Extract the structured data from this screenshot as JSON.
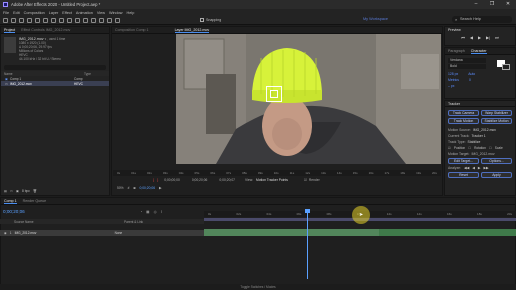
{
  "window": {
    "title": "Adobe After Effects 2020 - Untitled Project.aep *",
    "controls": [
      "–",
      "❐",
      "✕"
    ]
  },
  "menu": [
    "File",
    "Edit",
    "Composition",
    "Layer",
    "Effect",
    "Animation",
    "View",
    "Window",
    "Help"
  ],
  "toolbar": {
    "snapping_label": "Snapping",
    "workspace": "My Workspace",
    "search_placeholder": "Search Help"
  },
  "project": {
    "tabs": [
      "Project",
      "Effect Controls IMG_2012.mov"
    ],
    "file_name": "IMG_2012.mov",
    "file_used": "▾ , used 1 time",
    "file_info": [
      "1080 x 1920 (1.00)",
      "Δ 0;00;20;06, 29.97 fps",
      "Millions of Colors",
      "HEVC",
      "44.100 kHz / 32 bit U / Stereo"
    ],
    "columns": [
      "Name",
      "",
      "Type"
    ],
    "items": [
      {
        "name": "Comp 1",
        "type": "Comp"
      },
      {
        "name": "IMG_2012.mov",
        "type": "HEVC"
      }
    ],
    "footer_bpc": "8 bpc"
  },
  "composition": {
    "tab": "Composition Comp 1",
    "layer_tab": "Layer IMG_2012.mov",
    "ruler": [
      "0s",
      "01s",
      "02s",
      "03s",
      "04s",
      "05s",
      "06s",
      "07s",
      "08s",
      "09s",
      "10s",
      "11s",
      "12s",
      "13s",
      "14s",
      "15s",
      "16s",
      "17s",
      "18s",
      "19s",
      "20s"
    ],
    "time_in": "0;00;00;00",
    "time_current": "0;00;20;06",
    "time_duration": "0;00;20;07",
    "zoom": "50%",
    "view_label": "View:",
    "view_value": "Motion Tracker Points",
    "render_label": "Render",
    "timecode_bottom": "0;00;20;06"
  },
  "preview": {
    "title": "Preview"
  },
  "typography": {
    "tabs": [
      "Paragraph",
      "Character"
    ],
    "font": "Verdana",
    "style": "Bold",
    "size": "128 px",
    "leading": "Auto",
    "kerning": "Metrics",
    "tracking": "0",
    "stroke": "– px"
  },
  "tracker": {
    "title": "Tracker",
    "buttons": [
      "Track Camera",
      "Warp Stabilizer",
      "Track Motion",
      "Stabilize Motion"
    ],
    "motion_source_label": "Motion Source:",
    "motion_source": "IMG_2012.mov",
    "current_track_label": "Current Track:",
    "current_track": "Tracker 1",
    "track_type_label": "Track Type:",
    "track_type": "Stabilize",
    "checkboxes": [
      "Position",
      "Rotation",
      "Scale"
    ],
    "motion_target_label": "Motion Target:",
    "motion_target": "IMG_2012.mov",
    "edit_target": "Edit Target...",
    "options": "Options...",
    "analyze": "Analyze:",
    "reset": "Reset",
    "apply": "Apply"
  },
  "timeline": {
    "tabs": [
      "Comp 1",
      "Render Queue"
    ],
    "timecode": "0;00;20;06",
    "columns": [
      "Source Name",
      "Parent & Link"
    ],
    "layer": {
      "index": "1",
      "name": "IMG_2012.mov",
      "parent": "None"
    },
    "ruler": [
      "0s",
      "02s",
      "04s",
      "06s",
      "08s",
      "10s",
      "12s",
      "14s",
      "16s",
      "18s",
      "20s"
    ],
    "footer": "Toggle Switches / Modes"
  },
  "colors": {
    "accent": "#4a8ef0",
    "playhead": "#5aa0ff",
    "beanie": "#d7f23a",
    "track_bar": "#3f7a4a"
  },
  "icons": [
    "app-logo-icon",
    "search-icon",
    "play-icon",
    "camera-icon",
    "grid-icon",
    "tracker-point-icon"
  ]
}
